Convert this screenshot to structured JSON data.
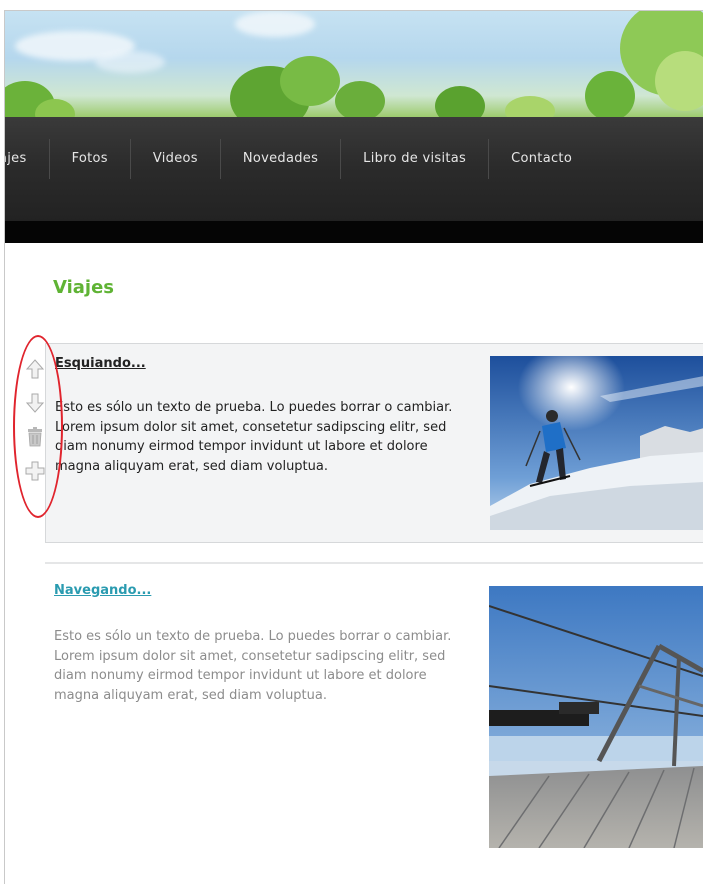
{
  "nav": {
    "items": [
      "ajes",
      "Fotos",
      "Videos",
      "Novedades",
      "Libro de visitas",
      "Contacto"
    ]
  },
  "page": {
    "title": "Viajes"
  },
  "articles": [
    {
      "title": "Esquiando...",
      "text": "Esto es sólo un texto de prueba. Lo puedes borrar o cambiar. Lorem ipsum dolor sit amet, consetetur sadipscing elitr, sed diam nonumy eirmod tempor invidunt ut labore et dolore magna aliquyam erat, sed diam voluptua.",
      "state": "selected"
    },
    {
      "title": "Navegando...",
      "text": "Esto es sólo un texto de prueba. Lo puedes borrar o cambiar. Lorem ipsum dolor sit amet, consetetur sadipscing elitr, sed diam nonumy eirmod tempor invidunt ut labore et dolore magna aliquyam erat, sed diam voluptua.",
      "state": "normal"
    }
  ],
  "controls": {
    "icons": [
      "arrow-up-icon",
      "arrow-down-icon",
      "trash-icon",
      "add-icon"
    ]
  },
  "colors": {
    "title_green": "#5fb334",
    "link_teal": "#2a9bb0",
    "nav_bg": "#2b2b2b",
    "highlight_red": "#e0242d"
  }
}
